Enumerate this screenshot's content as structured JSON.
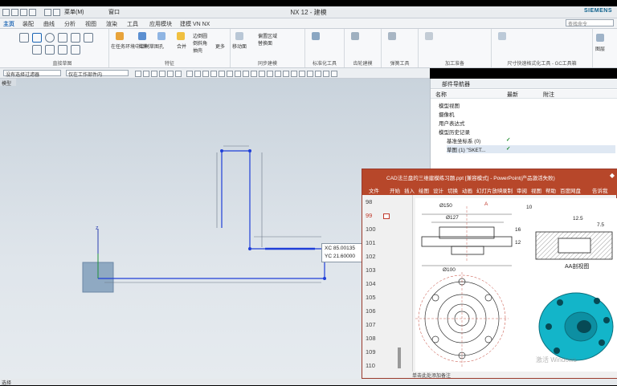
{
  "app": {
    "title": "NX 12 - 建模",
    "brand": "SIEMENS"
  },
  "quick_access": {
    "menu_label": "菜单(M)",
    "window_label": "窗口"
  },
  "ribbon_tabs": [
    {
      "label": "主页",
      "active": true
    },
    {
      "label": "装配"
    },
    {
      "label": "曲线"
    },
    {
      "label": "分析"
    },
    {
      "label": "视图"
    },
    {
      "label": "渲染"
    },
    {
      "label": "工具"
    },
    {
      "label": "应用模块"
    },
    {
      "label": "建模 VN NX"
    }
  ],
  "search": {
    "placeholder": "查找命令"
  },
  "ribbon_groups": [
    {
      "label": "直接草图"
    },
    {
      "label": "特征"
    },
    {
      "label": "同步建模"
    },
    {
      "label": "标准化工具"
    },
    {
      "label": "齿轮建模"
    },
    {
      "label": "弹簧工具"
    },
    {
      "label": "加工准备"
    },
    {
      "label": "尺寸快速格式化工具 - GC工具箱"
    }
  ],
  "ribbon_texts": {
    "sketch_task": "在任务环境中绘制草图",
    "extrude": "拉伸",
    "hole": "孔",
    "unite": "合并",
    "more": "更多",
    "edge_blend": "边倒圆",
    "chamfer": "倒斜角",
    "shell": "抽壳",
    "move_face": "移动面",
    "offset": "偏置区域",
    "replace": "替换面",
    "layer": "图层"
  },
  "selection": {
    "filter": "没有选择过滤器",
    "scope": "仅在工作部件内"
  },
  "left_strip": {
    "mode": "模式"
  },
  "graphics": {
    "tab_label": "模型"
  },
  "navigator": {
    "title": "部件导航器",
    "columns": [
      "名称",
      "最新",
      "附注"
    ],
    "rows": [
      {
        "label": "模型视图",
        "indent": 1,
        "status": ""
      },
      {
        "label": "摄像机",
        "indent": 1,
        "status": ""
      },
      {
        "label": "用户表达式",
        "indent": 1,
        "status": ""
      },
      {
        "label": "模型历史记录",
        "indent": 1,
        "status": ""
      },
      {
        "label": "基准坐标系 (0)",
        "indent": 2,
        "status": "✓"
      },
      {
        "label": "草图 (1) \"SKET...",
        "indent": 2,
        "status": "✓"
      }
    ]
  },
  "coords": {
    "xc": "XC  85.00135",
    "yc": "YC  21.60000"
  },
  "powerpoint": {
    "title": "CAD法兰盘的三维建模练习题.ppt [兼容模式] - PowerPoint(产品激活失败)",
    "menus": [
      "文件",
      "开始",
      "插入",
      "绘图",
      "设计",
      "切换",
      "动画",
      "幻灯片放映",
      "录制",
      "审阅",
      "视图",
      "帮助",
      "百度网盘",
      "告诉我"
    ],
    "slides": [
      "98",
      "99",
      "100",
      "101",
      "102",
      "103",
      "104",
      "105",
      "106",
      "107",
      "108",
      "109",
      "110"
    ],
    "selected_slide": "99",
    "drawing_labels": {
      "d150": "Ø150",
      "d127": "Ø127",
      "d100": "Ø100",
      "dim16": "16",
      "dim10": "10",
      "dim12_5": "12.5",
      "dim7_5": "7.5",
      "dim12": "12",
      "aa_view": "AA剖视图",
      "a_mark": "A",
      "watermark": "激活 Windows"
    },
    "notes": "单击此处添加备注"
  },
  "status_bar": {
    "text": "选择"
  }
}
